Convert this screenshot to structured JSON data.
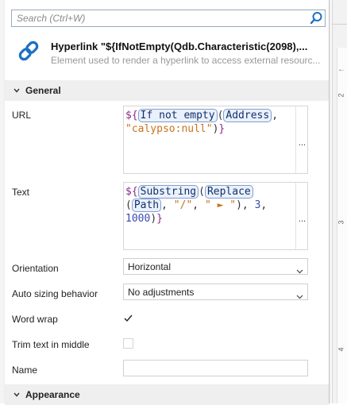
{
  "search": {
    "placeholder": "Search (Ctrl+W)"
  },
  "header": {
    "icon": "hyperlink-chain-icon",
    "title": "Hyperlink \"${IfNotEmpty(Qdb.Characteristic(2098),...",
    "description": "Element used to render a hyperlink to access external resourc..."
  },
  "sections": {
    "general": "General",
    "appearance": "Appearance"
  },
  "properties": {
    "url": {
      "label": "URL",
      "tokens": [
        "${",
        "If not empty",
        "(",
        "Address",
        ",",
        "\"calypso:null\"",
        ")",
        "}"
      ],
      "more": "..."
    },
    "text": {
      "label": "Text",
      "tokens": [
        "${",
        "Substring",
        "(",
        "Replace",
        "(",
        "Path",
        ", ",
        "\"/\"",
        ", ",
        "\" ► \"",
        "), ",
        "3",
        ",",
        "1000",
        ")",
        "}"
      ],
      "more": "..."
    },
    "orientation": {
      "label": "Orientation",
      "value": "Horizontal"
    },
    "auto_sizing": {
      "label": "Auto sizing behavior",
      "value": "No adjustments"
    },
    "word_wrap": {
      "label": "Word wrap",
      "checked": true
    },
    "trim_middle": {
      "label": "Trim text in middle",
      "checked": false
    },
    "name": {
      "label": "Name",
      "value": ""
    }
  },
  "colors": {
    "accent": "#1e6fc4",
    "function_token_bg": "#eaf1fb",
    "function_token_border": "#7f9fcf",
    "string_token": "#c9731b",
    "number_token": "#3a4bb0",
    "section_bg": "#efefef"
  },
  "background": {
    "ruler_ticks": [
      "2",
      "3",
      "4"
    ]
  }
}
